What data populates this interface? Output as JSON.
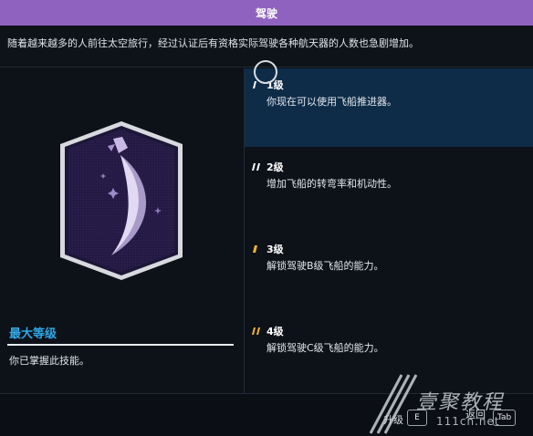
{
  "window": {
    "title": "驾驶"
  },
  "description": "随着越来越多的人前往太空旅行，经过认证后有资格实际驾驶各种航天器的人数也急剧增加。",
  "skill": {
    "badge_icon": "spaceship-trail-icon",
    "max_level_title": "最大等级",
    "max_level_desc": "你已掌握此技能。"
  },
  "levels": [
    {
      "name": "1级",
      "desc": "你现在可以使用飞船推进器。",
      "mark_color": "#ffffff",
      "active": true
    },
    {
      "name": "2级",
      "desc": "增加飞船的转弯率和机动性。",
      "mark_color": "#ffffff",
      "active": false
    },
    {
      "name": "3级",
      "desc": "解锁驾驶B级飞船的能力。",
      "mark_color": "#f2b630",
      "active": false
    },
    {
      "name": "4级",
      "desc": "解锁驾驶C级飞船的能力。",
      "mark_color": "#f2b630",
      "active": false
    }
  ],
  "footer": {
    "upgrade_label": "升级",
    "upgrade_key": "E",
    "back_label": "返回",
    "back_key": "Tab"
  },
  "watermark": {
    "text": "壹聚教程",
    "url": "111cn.net"
  },
  "colors": {
    "titlebar": "#8f62bf",
    "accent": "#2fa8e6",
    "active_row": "#0e2c48"
  }
}
